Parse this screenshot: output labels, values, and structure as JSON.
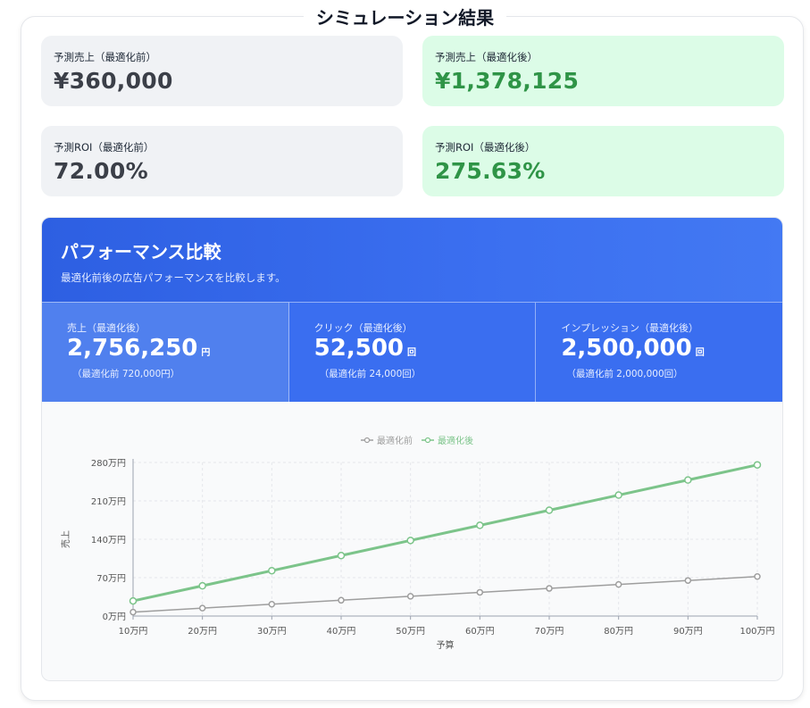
{
  "title": "シミュレーション結果",
  "cards": {
    "sales_before": {
      "label": "予測売上（最適化前）",
      "value": "¥360,000"
    },
    "sales_after": {
      "label": "予測売上（最適化後）",
      "value": "¥1,378,125"
    },
    "roi_before": {
      "label": "予測ROI（最適化前）",
      "value": "72.00%"
    },
    "roi_after": {
      "label": "予測ROI（最適化後）",
      "value": "275.63%"
    }
  },
  "performance": {
    "title": "パフォーマンス比較",
    "subtitle": "最適化前後の広告パフォーマンスを比較します。",
    "stats": [
      {
        "label": "売上（最適化後）",
        "value": "2,756,250",
        "unit": "円",
        "before": "（最適化前 720,000円）"
      },
      {
        "label": "クリック（最適化後）",
        "value": "52,500",
        "unit": "回",
        "before": "（最適化前 24,000回）"
      },
      {
        "label": "インプレッション（最適化後）",
        "value": "2,500,000",
        "unit": "回",
        "before": "（最適化前 2,000,000回）"
      }
    ]
  },
  "chart_data": {
    "type": "line",
    "x": [
      "10万円",
      "20万円",
      "30万円",
      "40万円",
      "50万円",
      "60万円",
      "70万円",
      "80万円",
      "90万円",
      "100万円"
    ],
    "xlabel": "予算",
    "ylabel": "売上",
    "ylim": [
      0,
      2800000
    ],
    "yticks": [
      0,
      700000,
      1400000,
      2100000,
      2800000
    ],
    "ytick_labels": [
      "0万円",
      "70万円",
      "140万円",
      "210万円",
      "280万円"
    ],
    "grid": true,
    "legend_position": "top",
    "series": [
      {
        "name": "最適化前",
        "color": "#9e9e9e",
        "values": [
          72000,
          144000,
          216000,
          288000,
          360000,
          432000,
          504000,
          576000,
          648000,
          720000
        ]
      },
      {
        "name": "最適化後",
        "color": "#7cc48a",
        "values": [
          275625,
          551250,
          826875,
          1102500,
          1378125,
          1653750,
          1929375,
          2205000,
          2480625,
          2756250
        ]
      }
    ]
  }
}
